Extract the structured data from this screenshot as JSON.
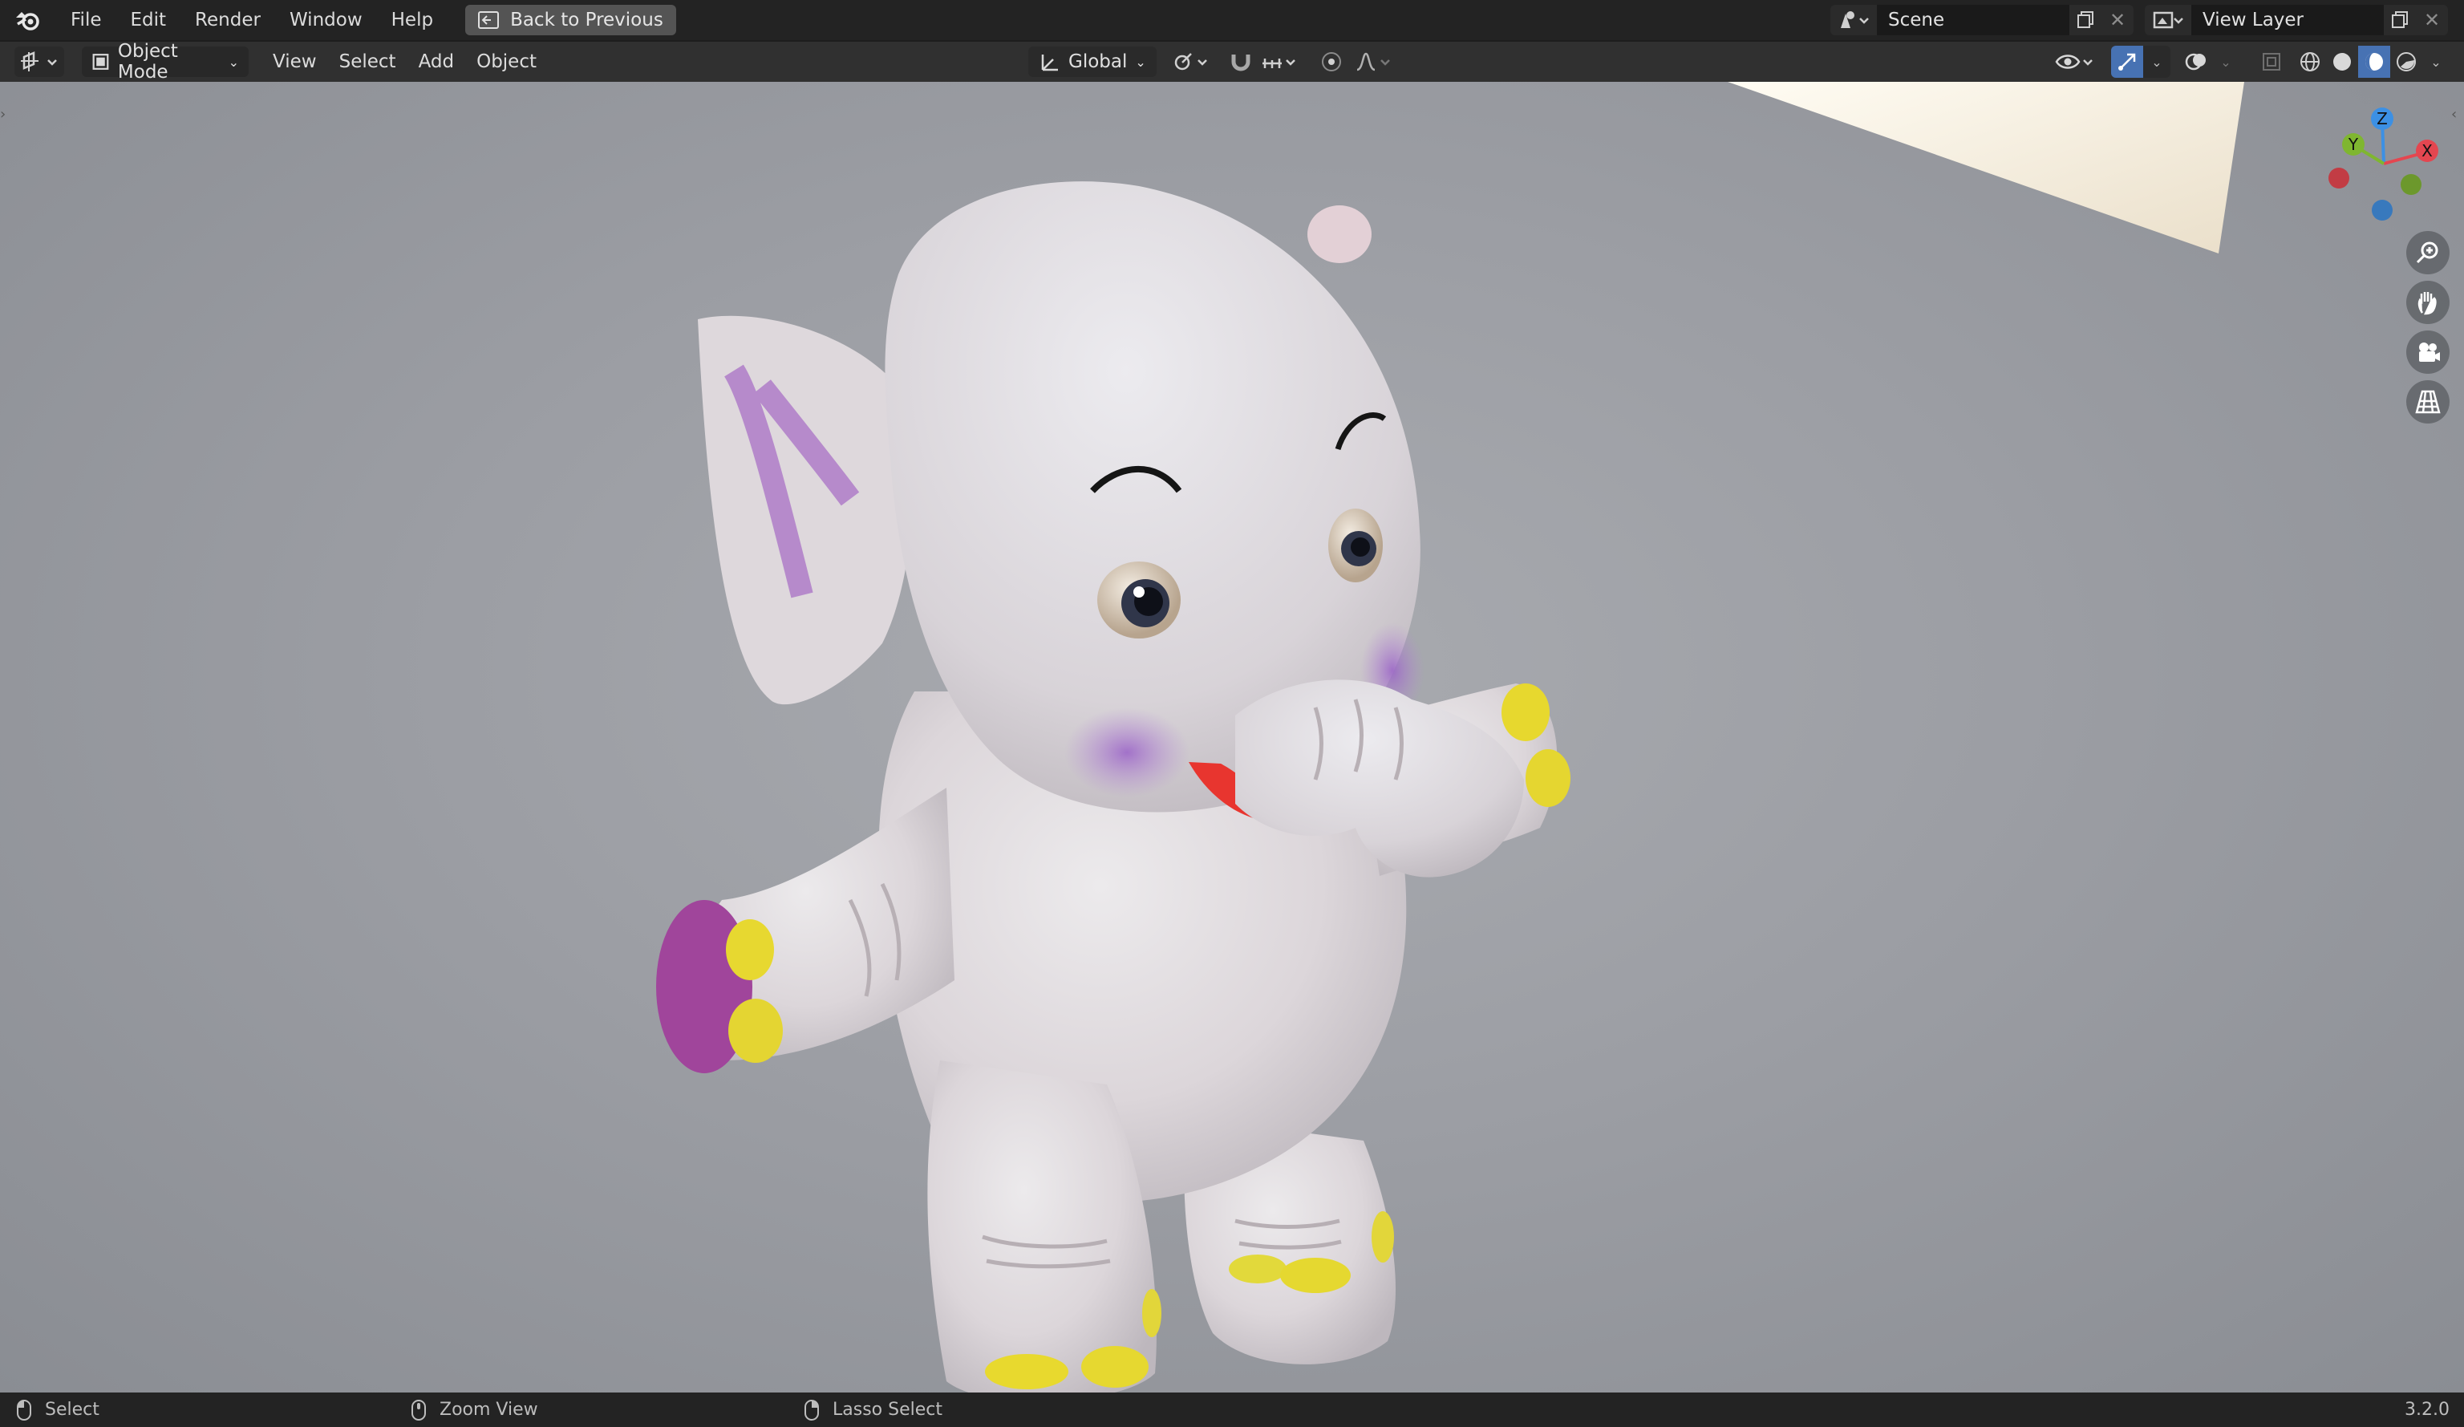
{
  "topbar": {
    "menu": [
      "File",
      "Edit",
      "Render",
      "Window",
      "Help"
    ],
    "back_button": "Back to Previous",
    "scene_name": "Scene",
    "view_layer_name": "View Layer"
  },
  "header": {
    "mode": "Object Mode",
    "menu": [
      "View",
      "Select",
      "Add",
      "Object"
    ],
    "transform_orientation": "Global"
  },
  "gizmo": {
    "z": "Z",
    "y": "Y",
    "x": "X"
  },
  "statusbar": {
    "select": "Select",
    "zoom_view": "Zoom View",
    "lasso_select": "Lasso Select",
    "version": "3.2.0"
  },
  "colors": {
    "axis_x": "#e44650",
    "axis_y": "#7fb630",
    "axis_z": "#3c90e4",
    "accent_active": "#4772b3"
  }
}
